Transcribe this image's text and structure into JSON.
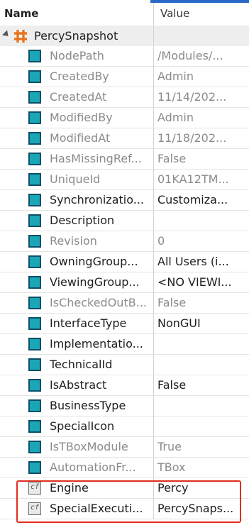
{
  "header": {
    "name_label": "Name",
    "value_label": "Value"
  },
  "root": {
    "label": "PercySnapshot",
    "icon": "component-icon"
  },
  "rows": [
    {
      "name": "NodePath",
      "value": "/Modules/...",
      "style": "gray",
      "icon": "property-icon"
    },
    {
      "name": "CreatedBy",
      "value": "Admin",
      "style": "gray",
      "icon": "property-icon"
    },
    {
      "name": "CreatedAt",
      "value": "11/14/202...",
      "style": "gray",
      "icon": "property-icon"
    },
    {
      "name": "ModifiedBy",
      "value": "Admin",
      "style": "gray",
      "icon": "property-icon"
    },
    {
      "name": "ModifiedAt",
      "value": "11/18/202...",
      "style": "gray",
      "icon": "property-icon"
    },
    {
      "name": "HasMissingRef...",
      "value": "False",
      "style": "gray",
      "icon": "property-icon"
    },
    {
      "name": "UniqueId",
      "value": "01KA12TM...",
      "style": "gray",
      "icon": "property-icon"
    },
    {
      "name": "Synchronizatio...",
      "value": "Customiza...",
      "style": "dark",
      "icon": "property-icon"
    },
    {
      "name": "Description",
      "value": "",
      "style": "dark",
      "icon": "property-icon"
    },
    {
      "name": "Revision",
      "value": "0",
      "style": "gray",
      "icon": "property-icon"
    },
    {
      "name": "OwningGroup...",
      "value": "All Users (i...",
      "style": "dark",
      "icon": "property-icon"
    },
    {
      "name": "ViewingGroup...",
      "value": "<NO VIEWI...",
      "style": "dark",
      "icon": "property-icon"
    },
    {
      "name": "IsCheckedOutB...",
      "value": "False",
      "style": "gray",
      "icon": "property-icon"
    },
    {
      "name": "InterfaceType",
      "value": "NonGUI",
      "style": "dark",
      "icon": "property-icon"
    },
    {
      "name": "Implementatio...",
      "value": "",
      "style": "dark",
      "icon": "property-icon"
    },
    {
      "name": "TechnicalId",
      "value": "",
      "style": "dark",
      "icon": "property-icon"
    },
    {
      "name": "IsAbstract",
      "value": "False",
      "style": "dark",
      "icon": "property-icon"
    },
    {
      "name": "BusinessType",
      "value": "",
      "style": "dark",
      "icon": "property-icon"
    },
    {
      "name": "SpecialIcon",
      "value": "",
      "style": "dark",
      "icon": "property-icon"
    },
    {
      "name": "IsTBoxModule",
      "value": "True",
      "style": "gray",
      "icon": "property-icon"
    },
    {
      "name": "AutomationFr...",
      "value": "TBox",
      "style": "gray",
      "icon": "property-icon"
    },
    {
      "name": "Engine",
      "value": "Percy",
      "style": "dark",
      "icon": "configuration-param-icon",
      "icon_text": "cf"
    },
    {
      "name": "SpecialExecuti...",
      "value": "PercySnaps...",
      "style": "dark",
      "icon": "configuration-param-icon",
      "icon_text": "cf"
    }
  ],
  "colors": {
    "accent": "#2a68c6",
    "highlight": "#e02e20",
    "property_icon": "#1ba6b8",
    "component_icon": "#e8731e"
  }
}
